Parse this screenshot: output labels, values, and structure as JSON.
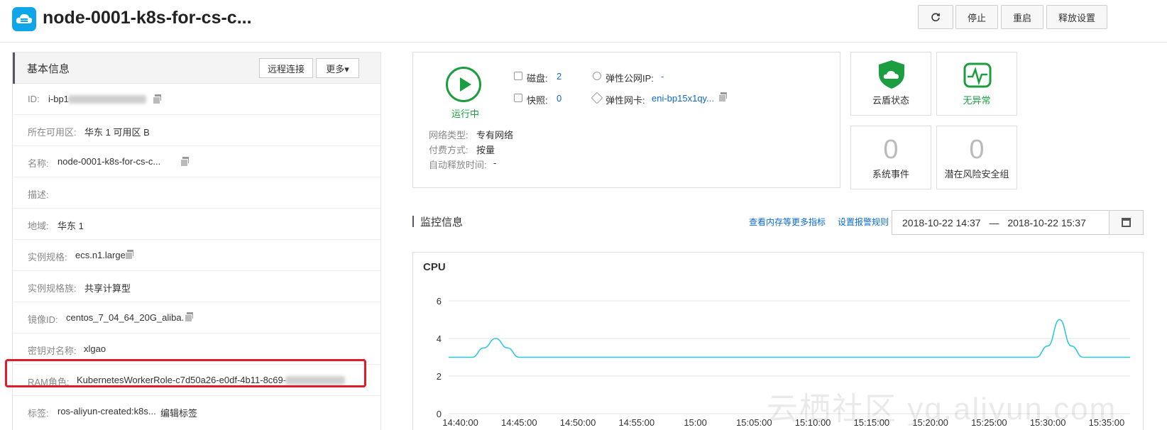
{
  "header": {
    "title": "node-0001-k8s-for-cs-c...",
    "buttons": [
      {
        "label": "停止"
      },
      {
        "label": "重启"
      },
      {
        "label": "释放设置"
      }
    ]
  },
  "basic_info": {
    "title": "基本信息",
    "remote_label": "远程连接",
    "more_label": "更多▾",
    "rows": [
      {
        "label": "ID:",
        "value": "i-bp1"
      },
      {
        "label": "所在可用区:",
        "value": "华东 1 可用区 B"
      },
      {
        "label": "名称:",
        "value": "node-0001-k8s-for-cs-c..."
      },
      {
        "label": "描述:",
        "value": ""
      },
      {
        "label": "地域:",
        "value": "华东 1"
      },
      {
        "label": "实例规格:",
        "value": "ecs.n1.large"
      },
      {
        "label": "实例规格族:",
        "value": "共享计算型"
      },
      {
        "label": "镜像ID:",
        "value": "centos_7_04_64_20G_aliba..."
      },
      {
        "label": "密钥对名称:",
        "value": "xlgao"
      },
      {
        "label": "RAM角色:",
        "value": "KubernetesWorkerRole-c7d50a26-e0df-4b11-8c69-"
      },
      {
        "label": "标签:",
        "value": "ros-aliyun-created:k8s...",
        "link": "编辑标签"
      }
    ]
  },
  "status": {
    "state": "运行中",
    "disk_label": "磁盘:",
    "disk_value": "2",
    "snapshot_label": "快照:",
    "snapshot_value": "0",
    "eip_label": "弹性公网IP:",
    "eip_value": "-",
    "eni_label": "弹性网卡:",
    "eni_value": "eni-bp15x1qy...",
    "network_label": "网络类型:",
    "network_value": "专有网络",
    "billing_label": "付费方式:",
    "billing_value": "按量",
    "release_label": "自动释放时间:",
    "release_value": "-"
  },
  "security": {
    "shield_label": "云盾状态",
    "ok_label": "无异常",
    "events_count": "0",
    "events_label": "系统事件",
    "risk_count": "0",
    "risk_label": "潜在风险安全组"
  },
  "monitor": {
    "title": "监控信息",
    "more_metrics": "查看内存等更多指标",
    "alarm_rules": "设置报警规则",
    "start": "2018-10-22 14:37",
    "dash": "—",
    "end": "2018-10-22 15:37"
  },
  "chart_data": {
    "type": "line",
    "title": "CPU",
    "x_ticks": [
      "14:40:00",
      "14:45:00",
      "14:50:00",
      "14:55:00",
      "15:00",
      "15:05:00",
      "15:10:00",
      "15:15:00",
      "15:20:00",
      "15:25:00",
      "15:30:00",
      "15:35:00"
    ],
    "y_ticks": [
      0,
      2,
      4,
      6
    ],
    "ylim": [
      0,
      6
    ],
    "xlim_minutes": [
      -1,
      57
    ],
    "series": [
      {
        "color": "#2ec7e0",
        "points": [
          [
            -1,
            3
          ],
          [
            1,
            3
          ],
          [
            2,
            3.5
          ],
          [
            3,
            4
          ],
          [
            4,
            3.5
          ],
          [
            5,
            3
          ],
          [
            49,
            3
          ],
          [
            50,
            3.6
          ],
          [
            51,
            5
          ],
          [
            52,
            3.6
          ],
          [
            53,
            3
          ],
          [
            57,
            3
          ]
        ]
      }
    ],
    "grid": true
  },
  "watermark": "云栖社区 yq.aliyun.com",
  "colors": {
    "accent": "#0a6ad1",
    "running": "#1a9e3f",
    "highlight": "#e01b2e",
    "series": "#2ec7e0"
  }
}
